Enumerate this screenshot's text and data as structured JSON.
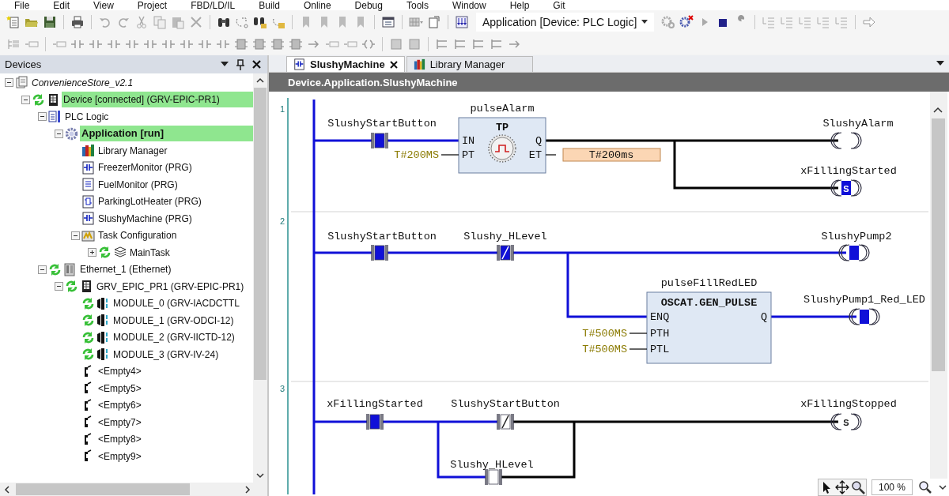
{
  "menu": [
    "File",
    "Edit",
    "View",
    "Project",
    "FBD/LD/IL",
    "Build",
    "Online",
    "Debug",
    "Tools",
    "Window",
    "Help",
    "Git"
  ],
  "toolbar": {
    "active_application": "Application [Device: PLC Logic]"
  },
  "devices_panel": {
    "title": "Devices",
    "tree": [
      {
        "label": "ConvenienceStore_v2.1",
        "kind": "project",
        "online": false,
        "highlighted": false,
        "expanded": true,
        "children": [
          {
            "label": "Device [connected] (GRV-EPIC-PR1)",
            "kind": "device",
            "online": true,
            "highlighted": true,
            "expanded": true,
            "children": [
              {
                "label": "PLC Logic",
                "kind": "plc-logic",
                "online": false,
                "highlighted": false,
                "expanded": true,
                "children": [
                  {
                    "label": "Application [run]",
                    "kind": "application",
                    "online": false,
                    "highlighted": true,
                    "expanded": true,
                    "children": [
                      {
                        "label": "Library Manager",
                        "kind": "library",
                        "online": false,
                        "highlighted": false
                      },
                      {
                        "label": "FreezerMonitor (PRG)",
                        "kind": "ld-pou",
                        "online": false,
                        "highlighted": false
                      },
                      {
                        "label": "FuelMonitor (PRG)",
                        "kind": "st-pou",
                        "online": false,
                        "highlighted": false
                      },
                      {
                        "label": "ParkingLotHeater (PRG)",
                        "kind": "cfc-pou",
                        "online": false,
                        "highlighted": false
                      },
                      {
                        "label": "SlushyMachine (PRG)",
                        "kind": "ld-pou",
                        "online": false,
                        "highlighted": false
                      },
                      {
                        "label": "Task Configuration",
                        "kind": "task-config",
                        "online": false,
                        "highlighted": false,
                        "expanded": true,
                        "children": [
                          {
                            "label": "MainTask",
                            "kind": "task",
                            "online": true,
                            "highlighted": false,
                            "expanded": false
                          }
                        ]
                      }
                    ]
                  }
                ]
              },
              {
                "label": "Ethernet_1 (Ethernet)",
                "kind": "ethernet",
                "online": true,
                "highlighted": false,
                "expanded": true,
                "children": [
                  {
                    "label": "GRV_EPIC_PR1 (GRV-EPIC-PR1)",
                    "kind": "device",
                    "online": true,
                    "highlighted": false,
                    "expanded": true,
                    "children": [
                      {
                        "label": "MODULE_0 (GRV-IACDCTTL",
                        "kind": "module",
                        "online": true,
                        "highlighted": false
                      },
                      {
                        "label": "MODULE_1 (GRV-ODCI-12)",
                        "kind": "module",
                        "online": true,
                        "highlighted": false
                      },
                      {
                        "label": "MODULE_2 (GRV-IICTD-12)",
                        "kind": "module",
                        "online": true,
                        "highlighted": false
                      },
                      {
                        "label": "MODULE_3 (GRV-IV-24)",
                        "kind": "module",
                        "online": true,
                        "highlighted": false
                      },
                      {
                        "label": "<Empty4>",
                        "kind": "empty-slot",
                        "online": false,
                        "highlighted": false
                      },
                      {
                        "label": "<Empty5>",
                        "kind": "empty-slot",
                        "online": false,
                        "highlighted": false
                      },
                      {
                        "label": "<Empty6>",
                        "kind": "empty-slot",
                        "online": false,
                        "highlighted": false
                      },
                      {
                        "label": "<Empty7>",
                        "kind": "empty-slot",
                        "online": false,
                        "highlighted": false
                      },
                      {
                        "label": "<Empty8>",
                        "kind": "empty-slot",
                        "online": false,
                        "highlighted": false
                      },
                      {
                        "label": "<Empty9>",
                        "kind": "empty-slot",
                        "online": false,
                        "highlighted": false
                      }
                    ]
                  }
                ]
              }
            ]
          }
        ]
      }
    ]
  },
  "editor": {
    "tabs": [
      {
        "label": "SlushyMachine",
        "kind": "ld",
        "selected": true,
        "closable": true
      },
      {
        "label": "Library Manager",
        "kind": "library",
        "selected": false,
        "closable": false
      }
    ],
    "path": "Device.Application.SlushyMachine",
    "networks": [
      {
        "number": "1",
        "elements": [
          {
            "kind": "contact",
            "variable": "SlushyStartButton",
            "on": true
          },
          {
            "kind": "block",
            "instance": "pulseAlarm",
            "type": "TP",
            "inputs": [
              {
                "pin": "IN"
              },
              {
                "pin": "PT",
                "value": "T#200MS"
              }
            ],
            "outputs": [
              {
                "pin": "Q",
                "on": false
              },
              {
                "pin": "ET",
                "monitor": "T#200ms"
              }
            ]
          },
          {
            "kind": "coil",
            "variable": "SlushyAlarm",
            "on": false
          },
          {
            "kind": "set-coil",
            "variable": "xFillingStarted",
            "symbol": "S",
            "on": true
          }
        ]
      },
      {
        "number": "2",
        "elements": [
          {
            "kind": "contact",
            "variable": "SlushyStartButton",
            "on": true
          },
          {
            "kind": "negated-contact",
            "variable": "Slushy_HLevel",
            "on": true
          },
          {
            "kind": "coil",
            "variable": "SlushyPump2",
            "on": true
          },
          {
            "kind": "block",
            "instance": "pulseFillRedLED",
            "type": "OSCAT.GEN_PULSE",
            "inputs": [
              {
                "pin": "ENQ"
              },
              {
                "pin": "PTH",
                "value": "T#500MS"
              },
              {
                "pin": "PTL",
                "value": "T#500MS"
              }
            ],
            "outputs": [
              {
                "pin": "Q",
                "on": true
              }
            ]
          },
          {
            "kind": "coil",
            "variable": "SlushyPump1_Red_LED",
            "on": true
          }
        ]
      },
      {
        "number": "3",
        "elements": [
          {
            "kind": "contact",
            "variable": "xFillingStarted",
            "on": true
          },
          {
            "kind": "negated-contact",
            "variable": "SlushyStartButton",
            "on": false
          },
          {
            "kind": "set-coil",
            "variable": "xFillingStopped",
            "symbol": "S",
            "on": false
          },
          {
            "kind": "contact",
            "variable": "Slushy_HLevel",
            "on": false
          }
        ]
      }
    ],
    "zoom_level": "100 %"
  }
}
